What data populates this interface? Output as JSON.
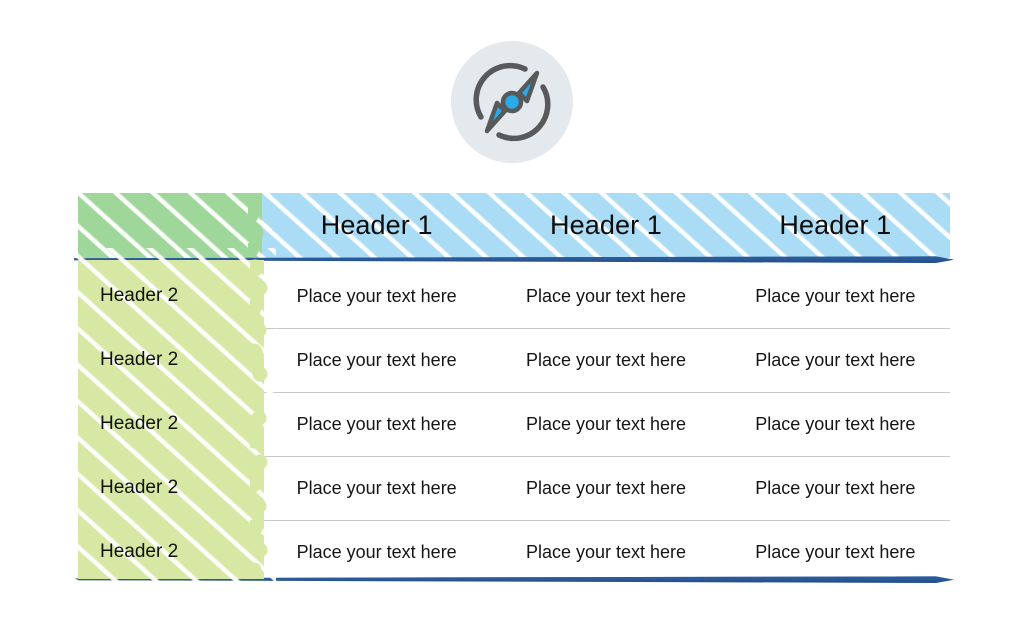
{
  "icon": {
    "name": "compass-refresh-icon",
    "circle_color": "#e3e9ec",
    "arrow_color": "#29abe8",
    "ring_color": "#58595b"
  },
  "colors": {
    "header_green": "#9fd79b",
    "header_blue": "#aadcf5",
    "body_green": "#d7e7a4",
    "bar_navy": "#24538f",
    "divider_gray": "#c8c8c8",
    "text_dark": "#0d0d0d"
  },
  "table": {
    "corner_label": "",
    "column_headers": [
      "Header 1",
      "Header 1",
      "Header 1"
    ],
    "rows": [
      {
        "head": "Header 2",
        "cells": [
          "Place your text here",
          "Place your text here",
          "Place your text here"
        ]
      },
      {
        "head": "Header 2",
        "cells": [
          "Place your text here",
          "Place your text here",
          "Place your text here"
        ]
      },
      {
        "head": "Header 2",
        "cells": [
          "Place your text here",
          "Place your text here",
          "Place your text here"
        ]
      },
      {
        "head": "Header 2",
        "cells": [
          "Place your text here",
          "Place your text here",
          "Place your text here"
        ]
      },
      {
        "head": "Header 2",
        "cells": [
          "Place your text here",
          "Place your text here",
          "Place your text here"
        ]
      }
    ]
  }
}
